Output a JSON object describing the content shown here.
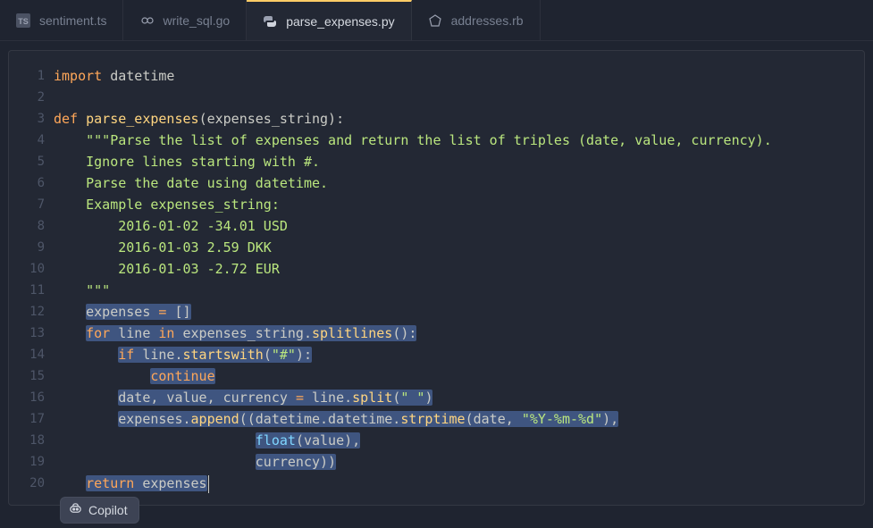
{
  "tabs": [
    {
      "icon": "ts",
      "label": "sentiment.ts",
      "active": false
    },
    {
      "icon": "go",
      "label": "write_sql.go",
      "active": false
    },
    {
      "icon": "py",
      "label": "parse_expenses.py",
      "active": true
    },
    {
      "icon": "rb",
      "label": "addresses.rb",
      "active": false
    }
  ],
  "copilot_label": "Copilot",
  "lines": [
    {
      "n": 1,
      "tokens": [
        [
          "kw",
          "import"
        ],
        [
          "cm",
          " datetime"
        ]
      ]
    },
    {
      "n": 2,
      "tokens": []
    },
    {
      "n": 3,
      "tokens": [
        [
          "kw",
          "def "
        ],
        [
          "fn",
          "parse_expenses"
        ],
        [
          "cm",
          "(expenses_string):"
        ]
      ]
    },
    {
      "n": 4,
      "tokens": [
        [
          "cm",
          "    "
        ],
        [
          "str",
          "\"\"\"Parse the list of expenses and return the list of triples (date, value, currency)."
        ]
      ]
    },
    {
      "n": 5,
      "tokens": [
        [
          "cm",
          "    "
        ],
        [
          "str",
          "Ignore lines starting with #."
        ]
      ]
    },
    {
      "n": 6,
      "tokens": [
        [
          "cm",
          "    "
        ],
        [
          "str",
          "Parse the date using datetime."
        ]
      ]
    },
    {
      "n": 7,
      "tokens": [
        [
          "cm",
          "    "
        ],
        [
          "str",
          "Example expenses_string:"
        ]
      ]
    },
    {
      "n": 8,
      "tokens": [
        [
          "cm",
          "    "
        ],
        [
          "str",
          "    2016-01-02 -34.01 USD"
        ]
      ]
    },
    {
      "n": 9,
      "tokens": [
        [
          "cm",
          "    "
        ],
        [
          "str",
          "    2016-01-03 2.59 DKK"
        ]
      ]
    },
    {
      "n": 10,
      "tokens": [
        [
          "cm",
          "    "
        ],
        [
          "str",
          "    2016-01-03 -2.72 EUR"
        ]
      ]
    },
    {
      "n": 11,
      "tokens": [
        [
          "cm",
          "    "
        ],
        [
          "str",
          "\"\"\""
        ]
      ]
    },
    {
      "n": 12,
      "tokens": [
        [
          "cm",
          "    "
        ],
        [
          "hl-open",
          ""
        ],
        [
          "cm",
          "expenses "
        ],
        [
          "kw",
          "="
        ],
        [
          "cm",
          " []"
        ],
        [
          "hl-close",
          ""
        ]
      ]
    },
    {
      "n": 13,
      "tokens": [
        [
          "cm",
          "    "
        ],
        [
          "hl-open",
          ""
        ],
        [
          "kw",
          "for"
        ],
        [
          "cm",
          " line "
        ],
        [
          "kw",
          "in"
        ],
        [
          "cm",
          " expenses_string."
        ],
        [
          "fn",
          "splitlines"
        ],
        [
          "cm",
          "():"
        ],
        [
          "hl-close",
          ""
        ]
      ]
    },
    {
      "n": 14,
      "tokens": [
        [
          "cm",
          "        "
        ],
        [
          "hl-open",
          ""
        ],
        [
          "kw",
          "if"
        ],
        [
          "cm",
          " line."
        ],
        [
          "fn",
          "startswith"
        ],
        [
          "cm",
          "("
        ],
        [
          "str",
          "\"#\""
        ],
        [
          "cm",
          "):"
        ],
        [
          "hl-close",
          ""
        ]
      ]
    },
    {
      "n": 15,
      "tokens": [
        [
          "cm",
          "            "
        ],
        [
          "hl-open",
          ""
        ],
        [
          "kw",
          "continue"
        ],
        [
          "hl-close",
          ""
        ]
      ]
    },
    {
      "n": 16,
      "tokens": [
        [
          "cm",
          "        "
        ],
        [
          "hl-open",
          ""
        ],
        [
          "cm",
          "date, value, currency "
        ],
        [
          "kw",
          "="
        ],
        [
          "cm",
          " line."
        ],
        [
          "fn",
          "split"
        ],
        [
          "cm",
          "("
        ],
        [
          "str",
          "\" \""
        ],
        [
          "cm",
          ")"
        ],
        [
          "hl-close",
          ""
        ]
      ]
    },
    {
      "n": 17,
      "tokens": [
        [
          "cm",
          "        "
        ],
        [
          "hl-open",
          ""
        ],
        [
          "cm",
          "expenses."
        ],
        [
          "fn",
          "append"
        ],
        [
          "cm",
          "((datetime.datetime."
        ],
        [
          "fn",
          "strptime"
        ],
        [
          "cm",
          "(date, "
        ],
        [
          "str",
          "\"%Y-%m-%d\""
        ],
        [
          "cm",
          "),"
        ],
        [
          "hl-close",
          ""
        ]
      ]
    },
    {
      "n": 18,
      "tokens": [
        [
          "cm",
          "                         "
        ],
        [
          "hl-open",
          ""
        ],
        [
          "type",
          "float"
        ],
        [
          "cm",
          "(value),"
        ],
        [
          "hl-close",
          ""
        ]
      ]
    },
    {
      "n": 19,
      "tokens": [
        [
          "cm",
          "                         "
        ],
        [
          "hl-open",
          ""
        ],
        [
          "cm",
          "currency))"
        ],
        [
          "hl-close",
          ""
        ]
      ]
    },
    {
      "n": 20,
      "tokens": [
        [
          "cm",
          "    "
        ],
        [
          "hl-open",
          ""
        ],
        [
          "kw",
          "return"
        ],
        [
          "cm",
          " expenses"
        ],
        [
          "hl-close",
          ""
        ],
        [
          "caret",
          ""
        ]
      ]
    }
  ]
}
